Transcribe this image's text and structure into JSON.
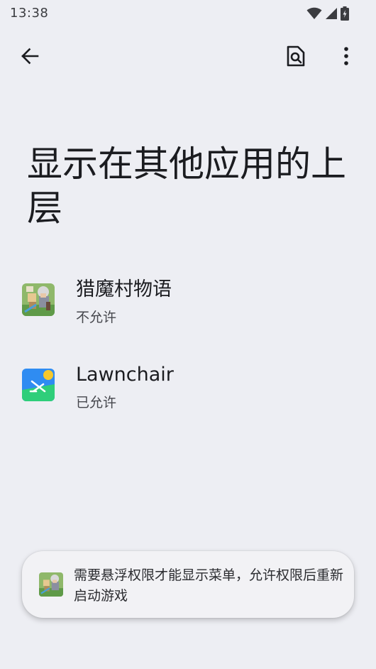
{
  "status_bar": {
    "time": "13:38"
  },
  "app_bar": {
    "back_icon": "arrow-left-icon",
    "search_icon": "search-document-icon",
    "more_icon": "more-vert-icon"
  },
  "page": {
    "title": "显示在其他应用的上层"
  },
  "apps": [
    {
      "name": "猎魔村物语",
      "status": "不允许",
      "icon": "game-character-icon"
    },
    {
      "name": "Lawnchair",
      "status": "已允许",
      "icon": "lawnchair-icon"
    }
  ],
  "toast": {
    "message": "需要悬浮权限才能显示菜单，允许权限后重新启动游戏",
    "icon": "game-character-icon"
  },
  "colors": {
    "background": "#edeef3",
    "text_primary": "#1b1c20",
    "text_secondary": "#45464c",
    "lawnchair_blue": "#2f8cf2",
    "lawnchair_green": "#2fce7a",
    "lawnchair_sun": "#f6c82c"
  }
}
